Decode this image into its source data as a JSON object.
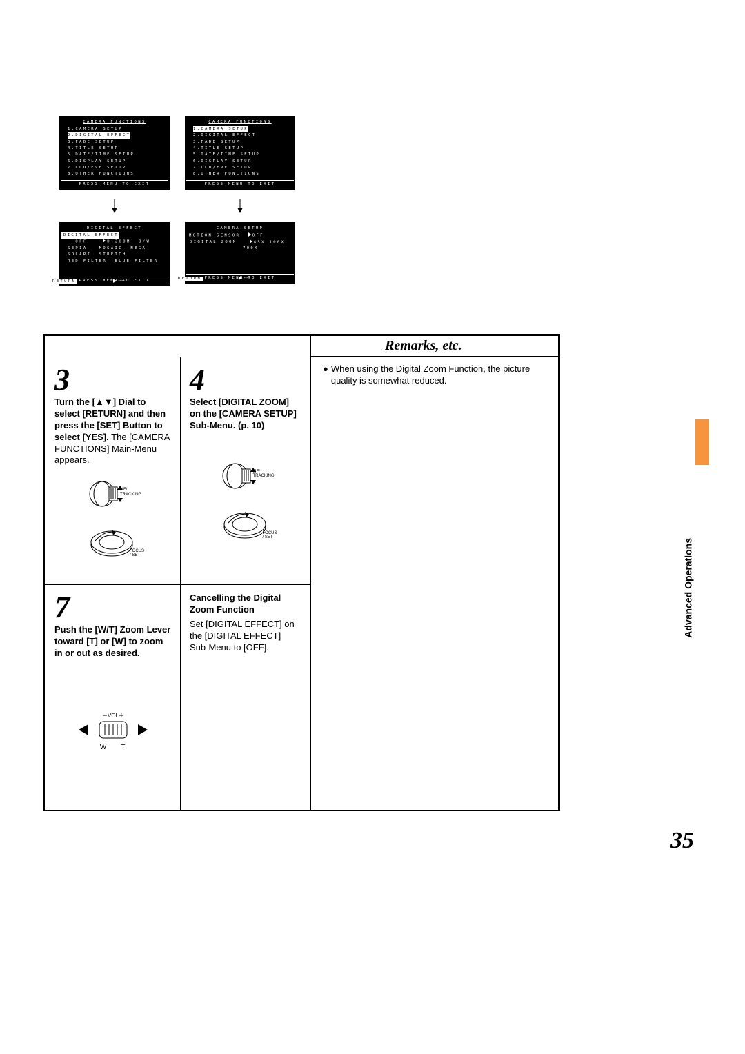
{
  "page_number": "35",
  "side_label": "Advanced Operations",
  "remarks": {
    "title": "Remarks, etc.",
    "body": "When using the Digital Zoom Function, the picture quality is somewhat reduced."
  },
  "screens": {
    "press_menu": "PRESS MENU TO EXIT",
    "left_top": {
      "title": "CAMERA FUNCTIONS",
      "lines": [
        "1.CAMERA SETUP",
        "2.DIGITAL EFFECT",
        "3.FADE SETUP",
        "4.TITLE SETUP",
        "5.DATE/TIME SETUP",
        "6.DISPLAY SETUP",
        "7.LCD/EVF SETUP",
        "8.OTHER FUNCTIONS"
      ],
      "highlight_index": 1
    },
    "right_top": {
      "title": "CAMERA FUNCTIONS",
      "lines": [
        "1.CAMERA SETUP",
        "2.DIGITAL EFFECT",
        "3.FADE SETUP",
        "4.TITLE SETUP",
        "5.DATE/TIME SETUP",
        "6.DISPLAY SETUP",
        "7.LCD/EVF SETUP",
        "8.OTHER FUNCTIONS"
      ],
      "highlight_index": 0
    },
    "left_bottom": {
      "title": "DIGITAL EFFECT",
      "row_label": "DIGITAL EFFECT",
      "r1": "OFF    ▶D.ZOOM  B/W",
      "r2": "SEPIA   MOSAIC  NEGA",
      "r3": "SOLARI  STRETCH",
      "r4": "RED FILTER  BLUE FILTER",
      "return": "RETURN",
      "return_dashes": "----"
    },
    "right_bottom": {
      "title": "CAMERA SETUP",
      "row1_label": "MOTION SENSOR",
      "row1_val": "OFF",
      "row2_label": "DIGITAL ZOOM",
      "row2_vals": "45X 100X",
      "row2_vals2": "700X",
      "return": "RETURN",
      "return_dashes": "----"
    }
  },
  "controls": {
    "dial_label": "MF/\nTRACKING",
    "knob_label": "FOCUS / SET",
    "vol_label": "－VOL＋",
    "w_label": "W",
    "t_label": "T"
  },
  "step3": {
    "num": "3",
    "bold": "Turn the [▲▼] Dial to select [RETURN] and then press the [SET] Button to select [YES].",
    "plain": "The [CAMERA FUNCTIONS] Main-Menu appears."
  },
  "step4": {
    "num": "4",
    "bold": "Select [DIGITAL ZOOM] on the [CAMERA SETUP] Sub-Menu. (p. 10)"
  },
  "step7": {
    "num": "7",
    "bold": "Push the [W/T] Zoom Lever toward [T] or [W] to zoom in or out as desired."
  },
  "cancel": {
    "title": "Cancelling the Digital Zoom Function",
    "body": "Set [DIGITAL EFFECT] on the [DIGITAL EFFECT] Sub-Menu to [OFF]."
  }
}
